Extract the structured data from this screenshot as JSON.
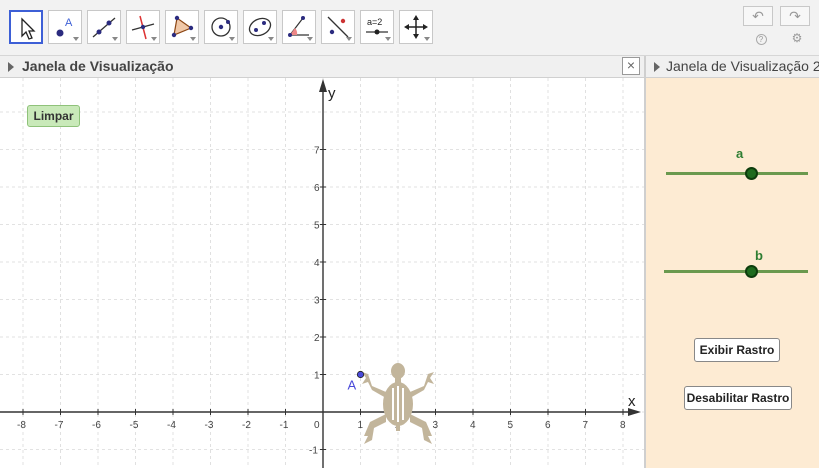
{
  "toolbar": {
    "tools": [
      {
        "name": "move-tool",
        "icon": "pointer-arrow-icon"
      },
      {
        "name": "point-tool",
        "icon": "point-A-icon",
        "label": "A"
      },
      {
        "name": "line-tool",
        "icon": "line-through-points-icon"
      },
      {
        "name": "perpendicular-tool",
        "icon": "perpendicular-line-icon"
      },
      {
        "name": "polygon-tool",
        "icon": "polygon-icon"
      },
      {
        "name": "circle-tool",
        "icon": "circle-center-point-icon"
      },
      {
        "name": "conic-tool",
        "icon": "ellipse-icon"
      },
      {
        "name": "angle-tool",
        "icon": "angle-icon"
      },
      {
        "name": "reflect-tool",
        "icon": "reflect-line-icon"
      },
      {
        "name": "slider-tool",
        "icon": "slider-icon",
        "label": "a=2"
      },
      {
        "name": "move-view-tool",
        "icon": "move-graphics-view-icon"
      }
    ],
    "undo_glyph": "↶",
    "redo_glyph": "↷",
    "help_glyph": "?",
    "settings_glyph": "⚙"
  },
  "left_view": {
    "title": "Janela de Visualização",
    "close_glyph": "×",
    "button_limpar": "Limpar"
  },
  "right_view": {
    "title": "Janela de Visualização 2",
    "slider_a": {
      "label": "a"
    },
    "slider_b": {
      "label": "b"
    },
    "button_exibir": "Exibir Rastro",
    "button_desabilitar": "Desabilitar Rastro"
  },
  "graph": {
    "x_axis_label": "x",
    "y_axis_label": "y",
    "x_ticks": [
      -8,
      -7,
      -6,
      -5,
      -4,
      -3,
      -2,
      -1,
      0,
      1,
      2,
      3,
      4,
      5,
      6,
      7,
      8
    ],
    "y_ticks": [
      -1,
      1,
      2,
      3,
      4,
      5,
      6,
      7
    ],
    "point": {
      "label": "A",
      "x": 1,
      "y": 1
    },
    "colors": {
      "grid": "#d9d9d9",
      "axis": "#333333",
      "point": "#4a4ad9",
      "turtle": "#c2b59b"
    }
  }
}
